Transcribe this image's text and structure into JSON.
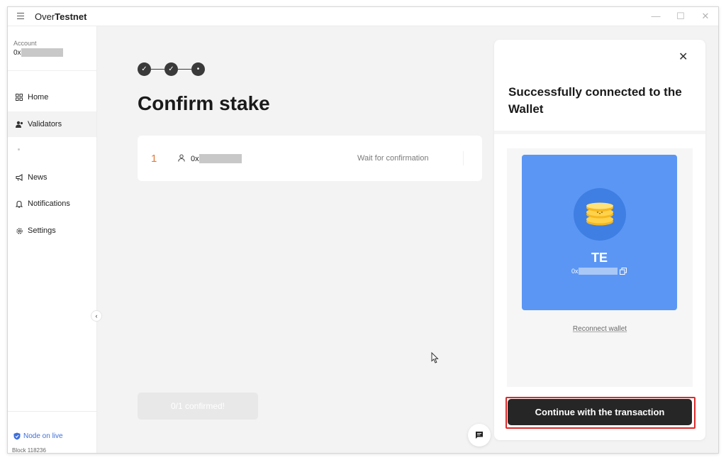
{
  "app": {
    "title_prefix": "Over",
    "title_bold": "Testnet",
    "window_controls": [
      "—",
      "☐",
      "✕"
    ]
  },
  "sidebar": {
    "account_label": "Account",
    "account_address_prefix": "0x",
    "items": [
      {
        "label": "Home",
        "icon": "grid-icon"
      },
      {
        "label": "Validators",
        "icon": "users-icon",
        "active": true
      },
      {
        "label": "News",
        "icon": "megaphone-icon"
      },
      {
        "label": "Notifications",
        "icon": "bell-icon"
      },
      {
        "label": "Settings",
        "icon": "gear-icon"
      }
    ],
    "node_status": "Node on live",
    "block": "Block 118236"
  },
  "main": {
    "steps": [
      "✓",
      "✓",
      "•"
    ],
    "title": "Confirm stake",
    "transaction": {
      "index": "1",
      "address_prefix": "0x",
      "status": "Wait for confirmation"
    },
    "confirmed_label": "0/1 confirmed!"
  },
  "wallet_panel": {
    "title": "Successfully connected to the Wallet",
    "wallet_name": "TE",
    "wallet_address_prefix": "0x",
    "reconnect_label": "Reconnect wallet",
    "continue_label": "Continue with the transaction"
  },
  "colors": {
    "wallet_card": "#5b96f4",
    "accent_orange": "#e07a3b",
    "node_blue": "#3f6fd8",
    "primary_button": "#262626",
    "highlight_red": "#d92b2b"
  }
}
